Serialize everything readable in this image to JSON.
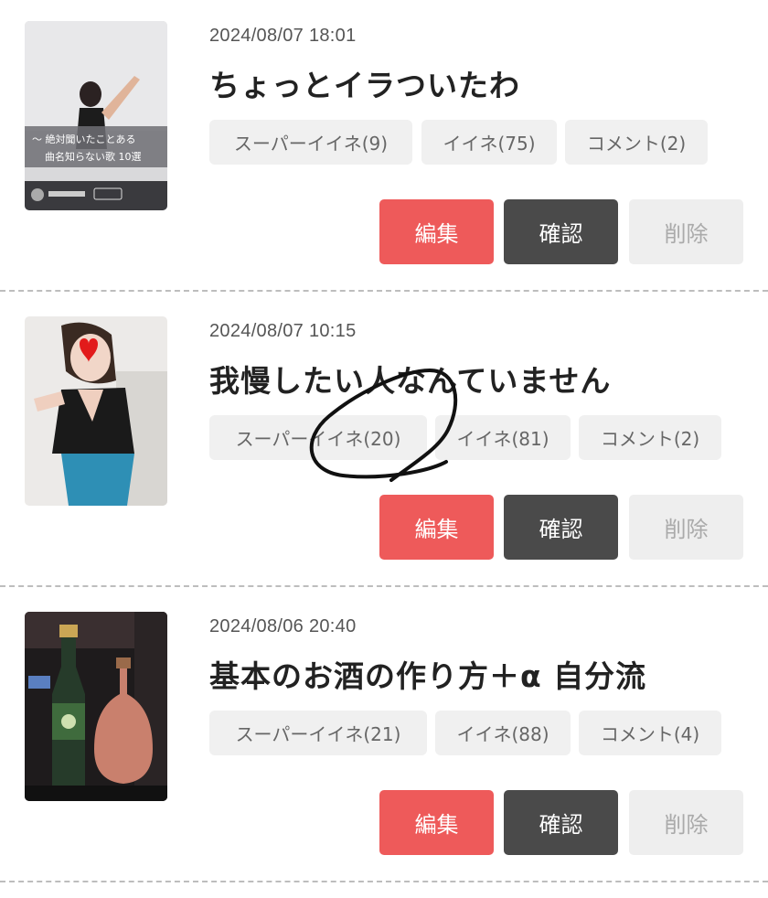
{
  "posts": [
    {
      "date": "2024/08/07 18:01",
      "title": "ちょっとイラついたわ",
      "thumbnail_caption": [
        "〜 絶対聞いたことある",
        "曲名知らない歌 10選"
      ],
      "stats": {
        "super_like": "スーパーイイネ(9)",
        "like": "イイネ(75)",
        "comment": "コメント(2)"
      },
      "actions": {
        "edit": "編集",
        "confirm": "確認",
        "delete": "削除"
      }
    },
    {
      "date": "2024/08/07 10:15",
      "title": "我慢したい人なんていません",
      "stats": {
        "super_like": "スーパーイイネ(20)",
        "like": "イイネ(81)",
        "comment": "コメント(2)"
      },
      "actions": {
        "edit": "編集",
        "confirm": "確認",
        "delete": "削除"
      }
    },
    {
      "date": "2024/08/06 20:40",
      "title": "基本のお酒の作り方＋α 自分流",
      "stats": {
        "super_like": "スーパーイイネ(21)",
        "like": "イイネ(88)",
        "comment": "コメント(4)"
      },
      "actions": {
        "edit": "編集",
        "confirm": "確認",
        "delete": "削除"
      }
    }
  ],
  "colors": {
    "edit": "#ee5a5a",
    "confirm": "#4a4a4a",
    "delete": "#eeeeee",
    "pill": "#f0f0f0"
  }
}
